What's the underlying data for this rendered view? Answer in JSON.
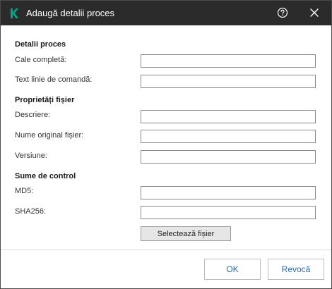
{
  "window": {
    "title": "Adaugă detalii proces",
    "icons": {
      "logo": "kaspersky-k-logo",
      "help": "help-circle-icon",
      "close": "close-icon"
    }
  },
  "sections": {
    "process": {
      "title": "Detalii proces",
      "full_path_label": "Cale completă:",
      "full_path_value": "",
      "command_line_label": "Text linie de comandă:",
      "command_line_value": ""
    },
    "file": {
      "title": "Proprietăți fișier",
      "description_label": "Descriere:",
      "description_value": "",
      "original_name_label": "Nume original fișier:",
      "original_name_value": "",
      "version_label": "Versiune:",
      "version_value": ""
    },
    "checksums": {
      "title": "Sume de control",
      "md5_label": "MD5:",
      "md5_value": "",
      "sha256_label": "SHA256:",
      "sha256_value": "",
      "select_file_label": "Selectează fișier"
    }
  },
  "footer": {
    "ok_label": "OK",
    "cancel_label": "Revocă"
  },
  "colors": {
    "titlebar": "#2b2b2b",
    "logo": "#00a88e",
    "button_text": "#2a6ab0"
  }
}
